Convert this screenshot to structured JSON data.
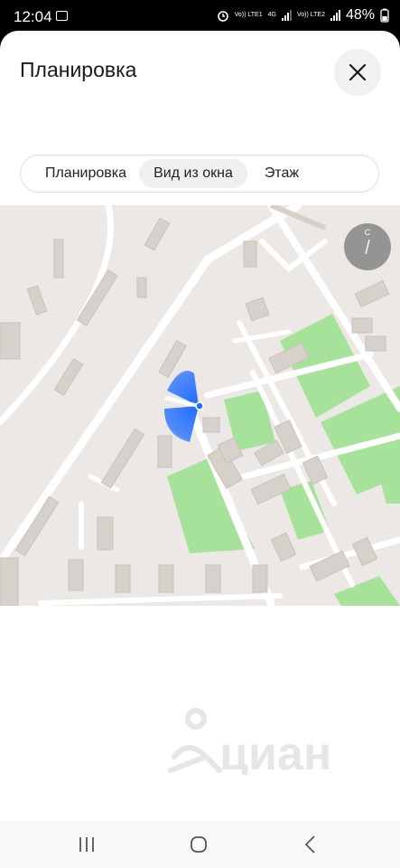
{
  "status": {
    "time": "12:04",
    "sim1_label": "Vo)) LTE1",
    "sim1_network": "4G",
    "sim2_label": "Vo)) LTE2",
    "battery": "48%"
  },
  "header": {
    "title": "Планировка"
  },
  "tabs": [
    {
      "label": "Планировка",
      "active": false
    },
    {
      "label": "Вид из окна",
      "active": true
    },
    {
      "label": "Этаж",
      "active": false
    }
  ],
  "map": {
    "compass_letter": "С",
    "colors": {
      "park": "#a7e29a",
      "land": "#ece8e5",
      "building": "#d7d1cc",
      "view_cone": "#1e6cff"
    }
  },
  "logo": {
    "text": "циан"
  },
  "colors": {
    "accent": "#1e6cff"
  }
}
